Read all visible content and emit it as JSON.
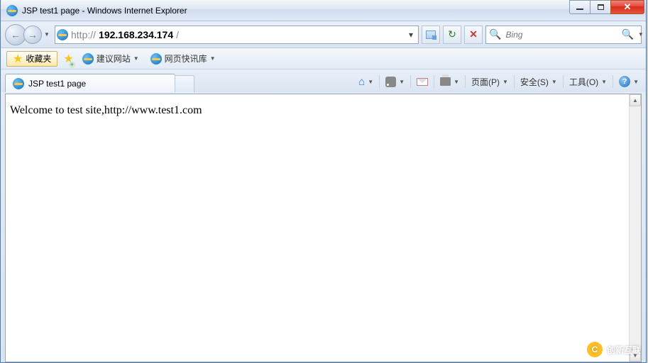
{
  "window": {
    "title": "JSP test1 page - Windows Internet Explorer"
  },
  "nav": {
    "url_prefix": "http://",
    "url_host": "192.168.234.174",
    "url_suffix": "/",
    "search_placeholder": "Bing"
  },
  "favbar": {
    "favorites_label": "收藏夹",
    "suggested_label": "建议网站",
    "webslice_label": "网页快讯库"
  },
  "tab": {
    "title": "JSP test1 page"
  },
  "cmdbar": {
    "page": "页面(P)",
    "safety": "安全(S)",
    "tools": "工具(O)"
  },
  "page": {
    "body": "Welcome to test site,http://www.test1.com"
  },
  "watermark": {
    "text": "创新互联"
  }
}
